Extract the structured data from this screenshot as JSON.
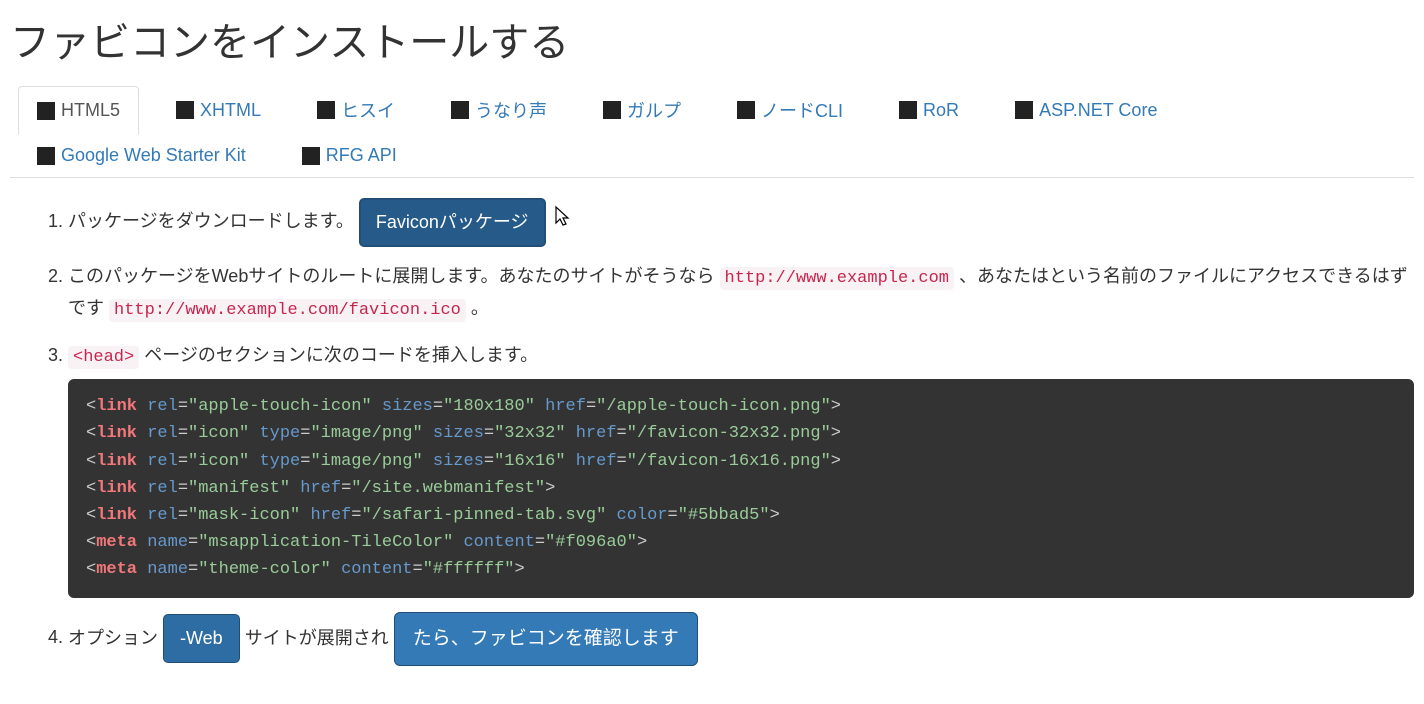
{
  "title": "ファビコンをインストールする",
  "tabs": [
    {
      "label": "HTML5",
      "active": true
    },
    {
      "label": "XHTML"
    },
    {
      "label": "ヒスイ"
    },
    {
      "label": "うなり声"
    },
    {
      "label": "ガルプ"
    },
    {
      "label": "ノードCLI"
    },
    {
      "label": "RoR"
    },
    {
      "label": "ASP.NET Core"
    },
    {
      "label": "Google Web Starter Kit"
    },
    {
      "label": "RFG API"
    }
  ],
  "step1": {
    "text": "パッケージをダウンロードします。",
    "button": "Faviconパッケージ"
  },
  "step2": {
    "text_a": "このパッケージをWebサイトのルートに展開します。あなたのサイトがそうなら",
    "url1": "http://www.example.com",
    "text_b": "、あなたはという名前のファイルにアクセスできるはずです",
    "url2": "http://www.example.com/favicon.ico",
    "text_c": "。"
  },
  "step3": {
    "tag": "<head>",
    "text": "ページのセクションに次のコードを挿入します。",
    "code_lines": [
      {
        "tag": "link",
        "attrs": [
          [
            "rel",
            "apple-touch-icon"
          ],
          [
            "sizes",
            "180x180"
          ],
          [
            "href",
            "/apple-touch-icon.png"
          ]
        ]
      },
      {
        "tag": "link",
        "attrs": [
          [
            "rel",
            "icon"
          ],
          [
            "type",
            "image/png"
          ],
          [
            "sizes",
            "32x32"
          ],
          [
            "href",
            "/favicon-32x32.png"
          ]
        ]
      },
      {
        "tag": "link",
        "attrs": [
          [
            "rel",
            "icon"
          ],
          [
            "type",
            "image/png"
          ],
          [
            "sizes",
            "16x16"
          ],
          [
            "href",
            "/favicon-16x16.png"
          ]
        ]
      },
      {
        "tag": "link",
        "attrs": [
          [
            "rel",
            "manifest"
          ],
          [
            "href",
            "/site.webmanifest"
          ]
        ]
      },
      {
        "tag": "link",
        "attrs": [
          [
            "rel",
            "mask-icon"
          ],
          [
            "href",
            "/safari-pinned-tab.svg"
          ],
          [
            "color",
            "#5bbad5"
          ]
        ]
      },
      {
        "tag": "meta",
        "attrs": [
          [
            "name",
            "msapplication-TileColor"
          ],
          [
            "content",
            "#f096a0"
          ]
        ]
      },
      {
        "tag": "meta",
        "attrs": [
          [
            "name",
            "theme-color"
          ],
          [
            "content",
            "#ffffff"
          ]
        ]
      }
    ]
  },
  "step4": {
    "text_a": "オプション",
    "btn1": "-Web",
    "text_b": "サイトが展開され",
    "btn2": "たら、ファビコンを確認します"
  }
}
